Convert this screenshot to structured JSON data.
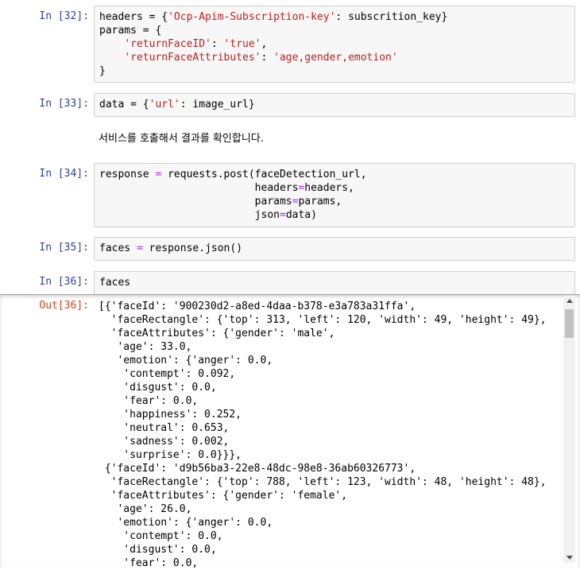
{
  "cells": {
    "c32": {
      "prompt": "In [32]:"
    },
    "c33": {
      "prompt": "In [33]:"
    },
    "c34": {
      "prompt": "In [34]:"
    },
    "c35": {
      "prompt": "In [35]:"
    },
    "c36": {
      "prompt": "In [36]:",
      "out_prompt": "Out[36]:"
    }
  },
  "markdown_text": "서비스를 호출해서 결과를 확인합니다.",
  "output_lines": [
    "[{'faceId': '900230d2-a8ed-4daa-b378-e3a783a31ffa',",
    "  'faceRectangle': {'top': 313, 'left': 120, 'width': 49, 'height': 49},",
    "  'faceAttributes': {'gender': 'male',",
    "   'age': 33.0,",
    "   'emotion': {'anger': 0.0,",
    "    'contempt': 0.092,",
    "    'disgust': 0.0,",
    "    'fear': 0.0,",
    "    'happiness': 0.252,",
    "    'neutral': 0.653,",
    "    'sadness': 0.002,",
    "    'surprise': 0.0}}},",
    " {'faceId': 'd9b56ba3-22e8-48dc-98e8-36ab60326773',",
    "  'faceRectangle': {'top': 788, 'left': 123, 'width': 48, 'height': 48},",
    "  'faceAttributes': {'gender': 'female',",
    "   'age': 26.0,",
    "   'emotion': {'anger': 0.0,",
    "    'contempt': 0.0,",
    "    'disgust': 0.0,",
    "    'fear': 0.0,"
  ]
}
